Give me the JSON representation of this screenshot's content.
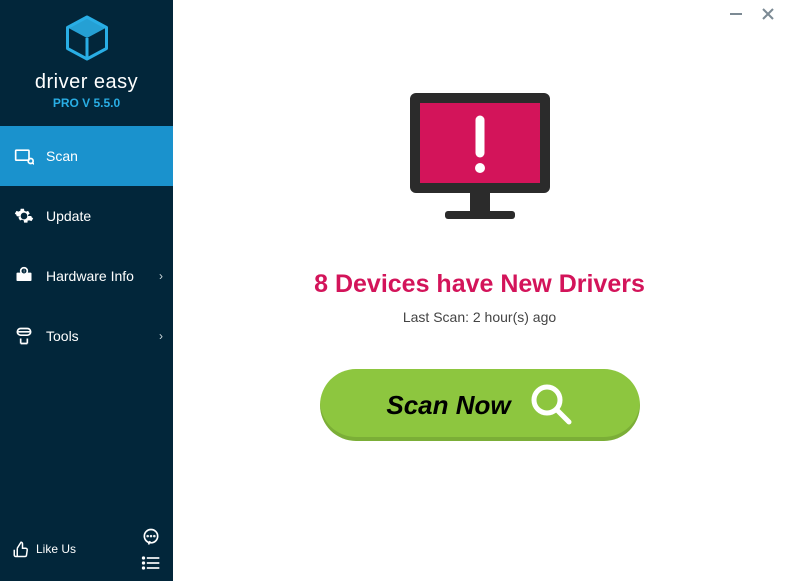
{
  "brand": "driver easy",
  "version": "PRO V 5.5.0",
  "sidebar": {
    "items": [
      {
        "label": "Scan",
        "icon": "scan",
        "active": true,
        "chevron": false
      },
      {
        "label": "Update",
        "icon": "update",
        "active": false,
        "chevron": false
      },
      {
        "label": "Hardware Info",
        "icon": "hardware",
        "active": false,
        "chevron": true
      },
      {
        "label": "Tools",
        "icon": "tools",
        "active": false,
        "chevron": true
      }
    ],
    "like": "Like Us"
  },
  "main": {
    "headline": "8 Devices have New Drivers",
    "subline": "Last Scan: 2 hour(s) ago",
    "button": "Scan Now"
  },
  "colors": {
    "accent": "#d3145a",
    "green": "#8dc63f",
    "blue": "#1a92cd",
    "dark": "#02263a"
  }
}
